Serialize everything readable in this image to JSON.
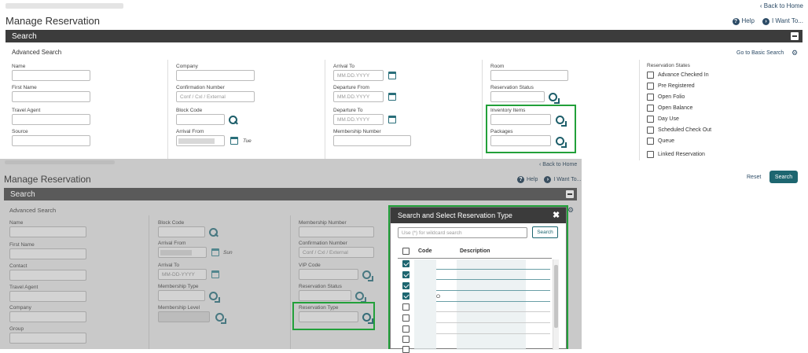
{
  "top": {
    "back_to_home": "Back to Home",
    "title": "Manage Reservation",
    "help": "Help",
    "i_want_to": "I Want To...",
    "search_bar": "Search",
    "advanced_search": "Advanced Search",
    "go_basic": "Go to Basic Search",
    "col1": {
      "name": "Name",
      "first_name": "First Name",
      "travel_agent": "Travel Agent",
      "source": "Source"
    },
    "col2": {
      "company": "Company",
      "confirmation_number": "Confirmation Number",
      "conf_placeholder": "Conf / Cxl / External",
      "block_code": "Block Code",
      "arrival_from": "Arrival From",
      "arrival_day": "Tue"
    },
    "col3": {
      "arrival_to": "Arrival To",
      "date_placeholder": "MM.DD.YYYY",
      "departure_from": "Departure From",
      "departure_to": "Departure To",
      "membership_number": "Membership Number"
    },
    "col4": {
      "room": "Room",
      "reservation_status": "Reservation Status",
      "inventory_items": "Inventory Items",
      "packages": "Packages"
    },
    "states": {
      "title": "Reservation States",
      "items": [
        "Advance Checked In",
        "Pre Registered",
        "Open Folio",
        "Open Balance",
        "Day Use",
        "Scheduled Check Out",
        "Queue",
        "Linked Reservation"
      ]
    },
    "reset": "Reset",
    "search_button": "Search"
  },
  "bottom": {
    "back_to_home": "Back to Home",
    "title": "Manage Reservation",
    "help": "Help",
    "i_want_to": "I Want To...",
    "search_bar": "Search",
    "advanced_search": "Advanced Search",
    "col1": {
      "name": "Name",
      "first_name": "First Name",
      "contact": "Contact",
      "travel_agent": "Travel Agent",
      "company": "Company",
      "group": "Group"
    },
    "col2": {
      "block_code": "Block Code",
      "arrival_from": "Arrival From",
      "arrival_day": "Sun",
      "arrival_to": "Arrival To",
      "date_placeholder": "MM-DD-YYYY",
      "membership_type": "Membership Type",
      "membership_level": "Membership Level"
    },
    "col3": {
      "membership_number": "Membership Number",
      "confirmation_number": "Confirmation Number",
      "conf_placeholder": "Conf / Cxl / External",
      "vip_code": "VIP Code",
      "reservation_status": "Reservation Status",
      "reservation_type": "Reservation Type"
    }
  },
  "dialog": {
    "title": "Search and Select Reservation Type",
    "search_placeholder": "Use (*) for wildcard search",
    "search_button": "Search",
    "col_code": "Code",
    "col_description": "Description",
    "row_fragment": "O",
    "rows_checked": [
      true,
      true,
      true,
      true,
      false,
      false,
      false,
      false,
      false
    ]
  },
  "colors": {
    "accent": "#1d6670",
    "highlight": "#22a03a",
    "header": "#3c3c3c"
  }
}
